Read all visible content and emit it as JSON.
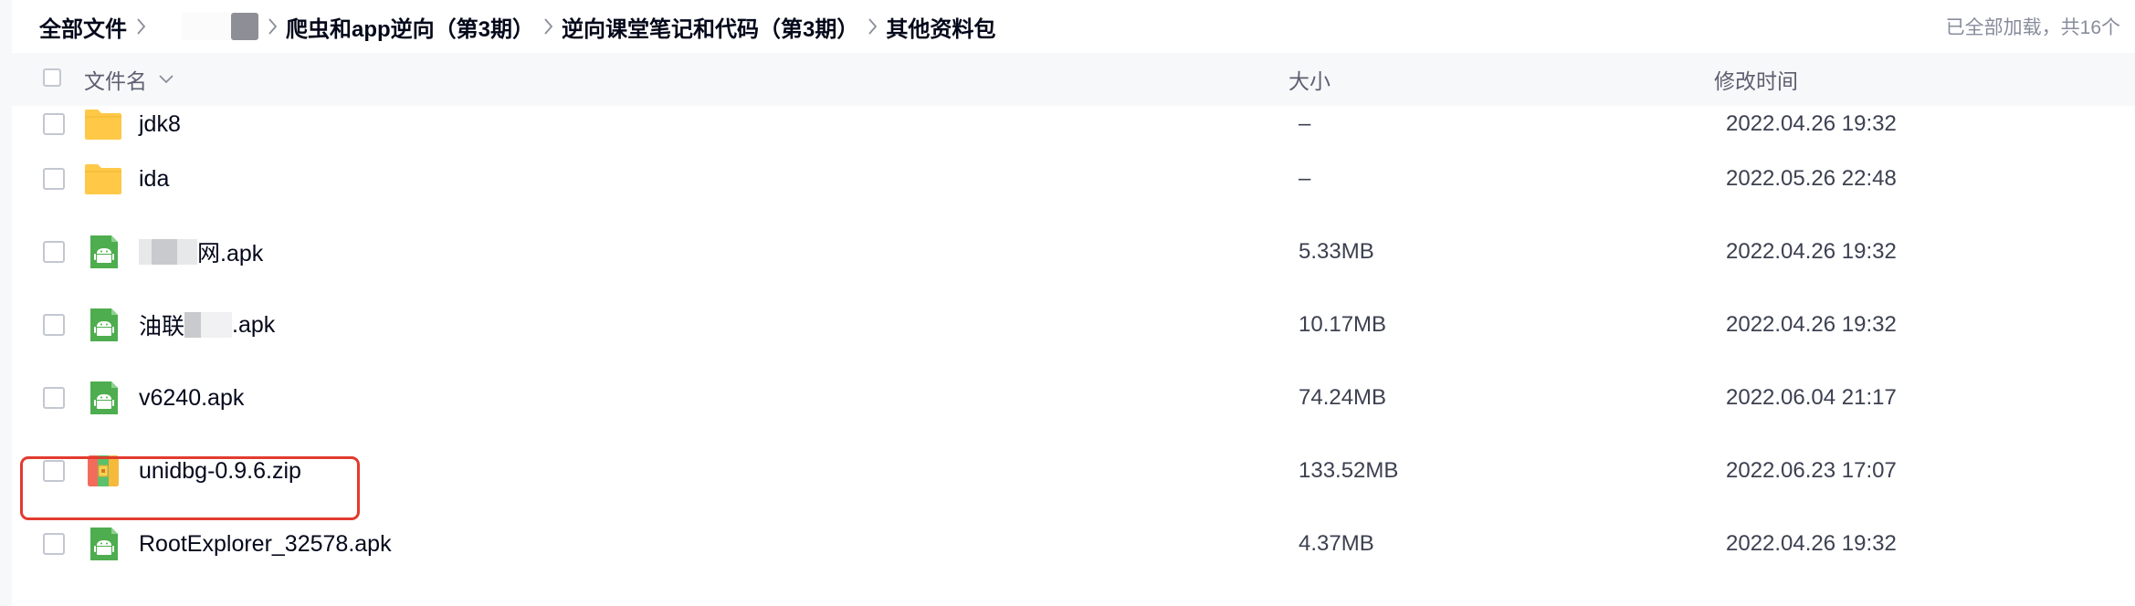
{
  "breadcrumb": {
    "root": "全部文件",
    "items": [
      "爬虫和app逆向（第3期）",
      "逆向课堂笔记和代码（第3期）",
      "其他资料包"
    ],
    "status": "已全部加载，共16个"
  },
  "table": {
    "columns": {
      "name": "文件名",
      "size": "大小",
      "modified": "修改时间"
    },
    "rows": [
      {
        "type": "folder",
        "name": "jdk8",
        "size": "–",
        "modified": "2022.04.26 19:32"
      },
      {
        "type": "folder",
        "name": "ida",
        "size": "–",
        "modified": "2022.05.26 22:48"
      },
      {
        "type": "apk",
        "name_prefix": "",
        "name_suffix": "网.apk",
        "size": "5.33MB",
        "modified": "2022.04.26 19:32"
      },
      {
        "type": "apk",
        "name_prefix": "油联",
        "name_suffix": ".apk",
        "size": "10.17MB",
        "modified": "2022.04.26 19:32"
      },
      {
        "type": "apk",
        "name": "v6240.apk",
        "size": "74.24MB",
        "modified": "2022.06.04 21:17"
      },
      {
        "type": "zip",
        "name": "unidbg-0.9.6.zip",
        "size": "133.52MB",
        "modified": "2022.06.23 17:07"
      },
      {
        "type": "apk",
        "name": "RootExplorer_32578.apk",
        "size": "4.37MB",
        "modified": "2022.04.26 19:32"
      }
    ]
  },
  "icons": {
    "folder": "folder-icon",
    "apk": "android-apk-icon",
    "zip": "zip-archive-icon",
    "separator": "chevron-right-icon",
    "sort": "chevron-down-icon"
  },
  "colors": {
    "folder": "#ffc846",
    "apk": "#4ead4f",
    "highlight_border": "#e23b2e",
    "header_bg": "#f7f8fa"
  }
}
